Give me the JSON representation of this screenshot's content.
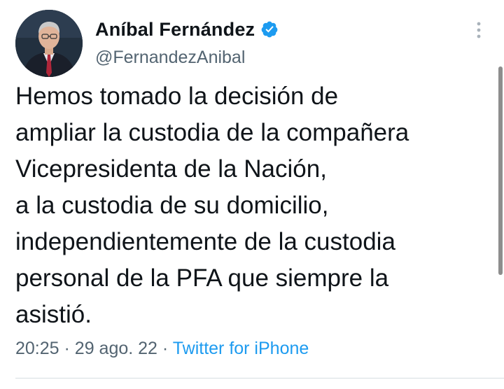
{
  "author": {
    "name": "Aníbal Fernández",
    "handle": "@FernandezAnibal",
    "verified": true
  },
  "tweet": {
    "lines": [
      "Hemos tomado la decisión de",
      "ampliar la custodia de la compañera",
      "Vicepresidenta de la Nación,",
      "a la custodia de su domicilio,",
      "independientemente de la custodia",
      "personal de la PFA que siempre la",
      "asistió."
    ]
  },
  "meta": {
    "time": "20:25",
    "separator": "·",
    "date": "29 ago. 22",
    "source": "Twitter for iPhone"
  },
  "icons": {
    "verified": "verified-badge-icon",
    "more": "more-options-icon"
  },
  "colors": {
    "text": "#0f1419",
    "secondary": "#536471",
    "link": "#1d9bf0",
    "verified": "#1d9bf0"
  }
}
